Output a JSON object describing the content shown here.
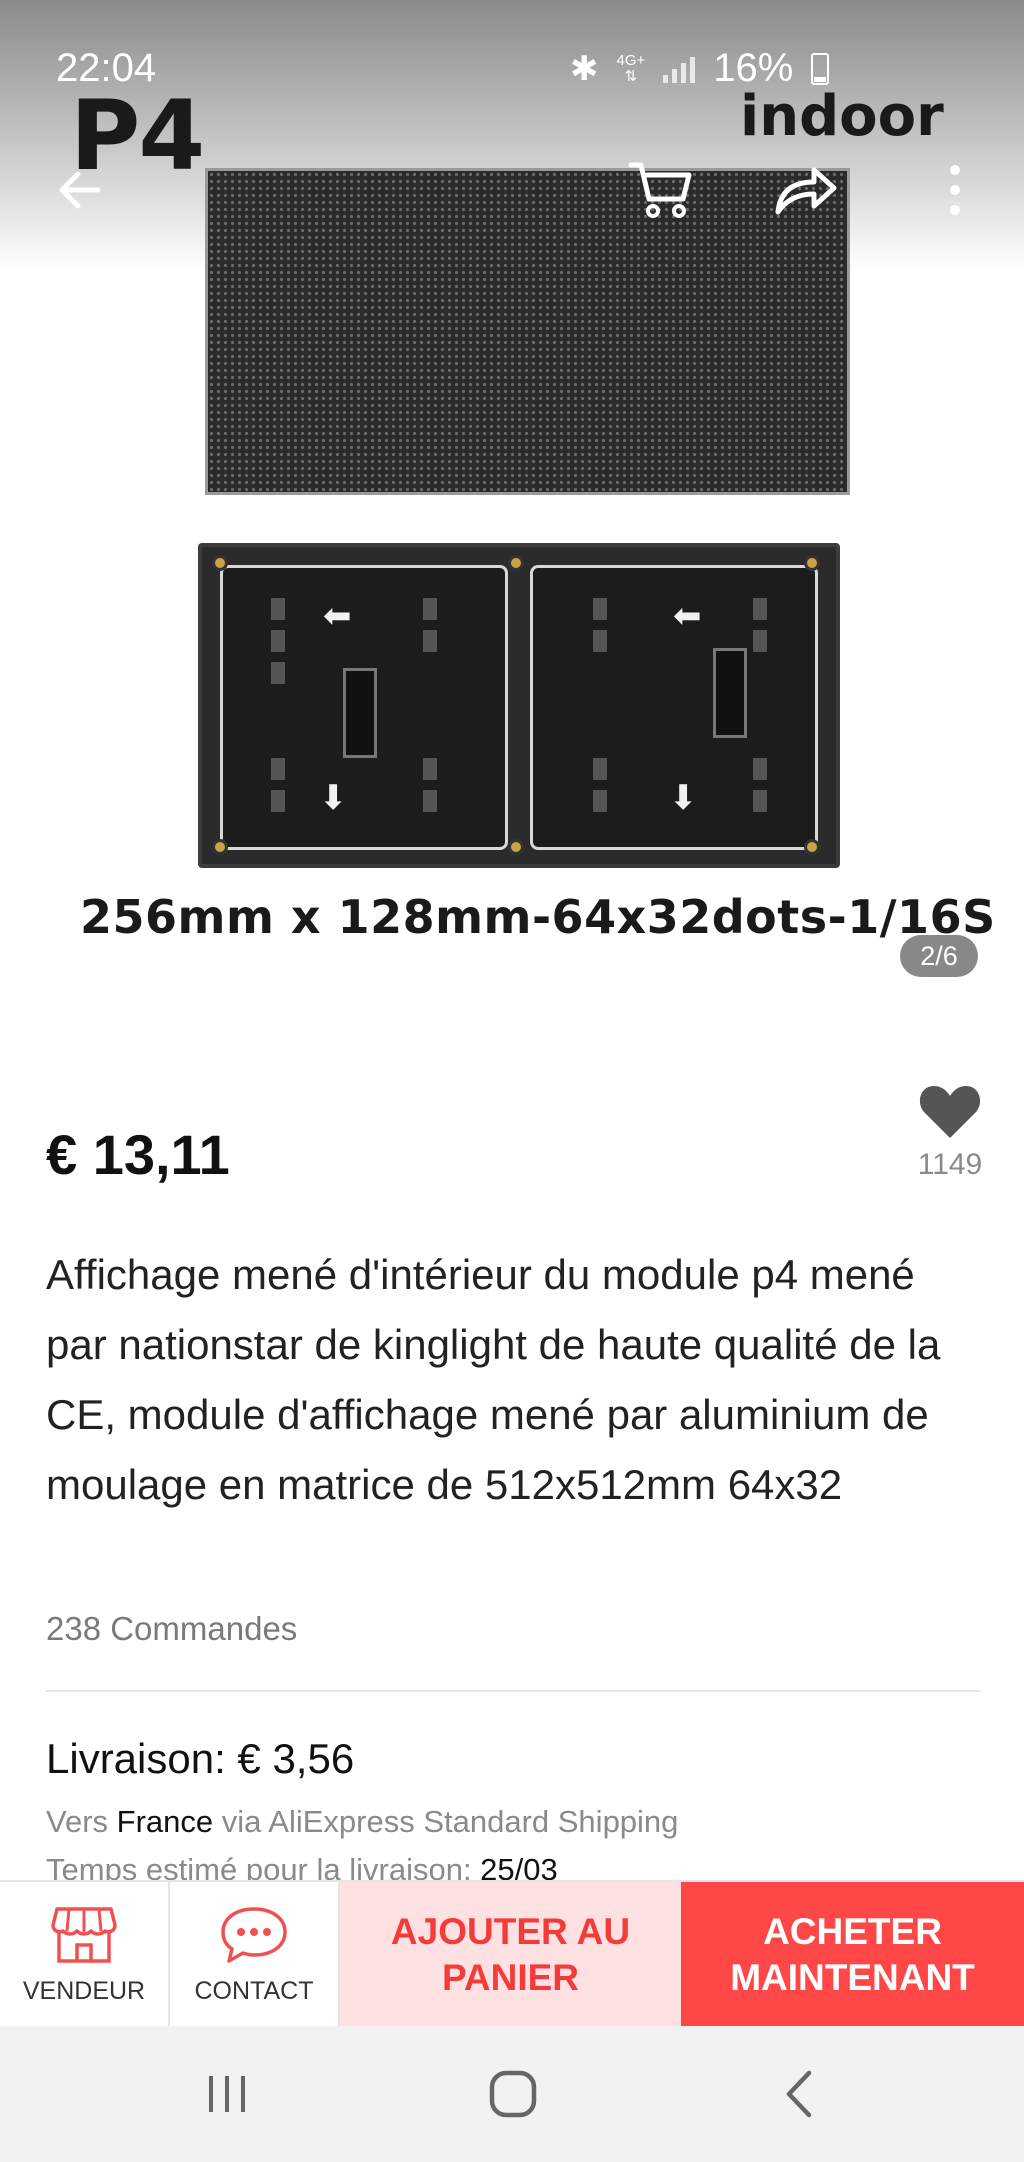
{
  "status_bar": {
    "time": "22:04",
    "network": "4G+",
    "battery": "16%"
  },
  "product_image": {
    "label_model": "P4",
    "label_type": "indoor",
    "label_dimensions": "256mm x 128mm-64x32dots-1/16S",
    "page_counter": "2/6"
  },
  "top_nav": {
    "back_icon": "arrow-left-icon",
    "cart_icon": "cart-icon",
    "share_icon": "share-icon",
    "more_icon": "more-vertical-icon"
  },
  "product": {
    "price": "€ 13,11",
    "wishlist_count": "1149",
    "title": "Affichage mené d'intérieur du module p4 mené par nationstar de kinglight de haute qualité de la CE, module d'affichage mené par aluminium de moulage en matrice de 512x512mm 64x32",
    "orders": "238 Commandes"
  },
  "shipping": {
    "title": "Livraison: € 3,56",
    "dest_prefix": "Vers ",
    "destination": "France",
    "dest_suffix": " via AliExpress Standard Shipping",
    "eta_prefix": "Temps estimé pour la livraison: ",
    "eta_date": "25/03"
  },
  "action_bar": {
    "seller_label": "VENDEUR",
    "contact_label": "CONTACT",
    "add_to_cart_label": "AJOUTER AU PANIER",
    "buy_now_label": "ACHETER MAINTENANT"
  },
  "colors": {
    "accent_red": "#ff4747",
    "cart_bg": "#ffe1e1",
    "cart_text": "#f23b3b"
  }
}
